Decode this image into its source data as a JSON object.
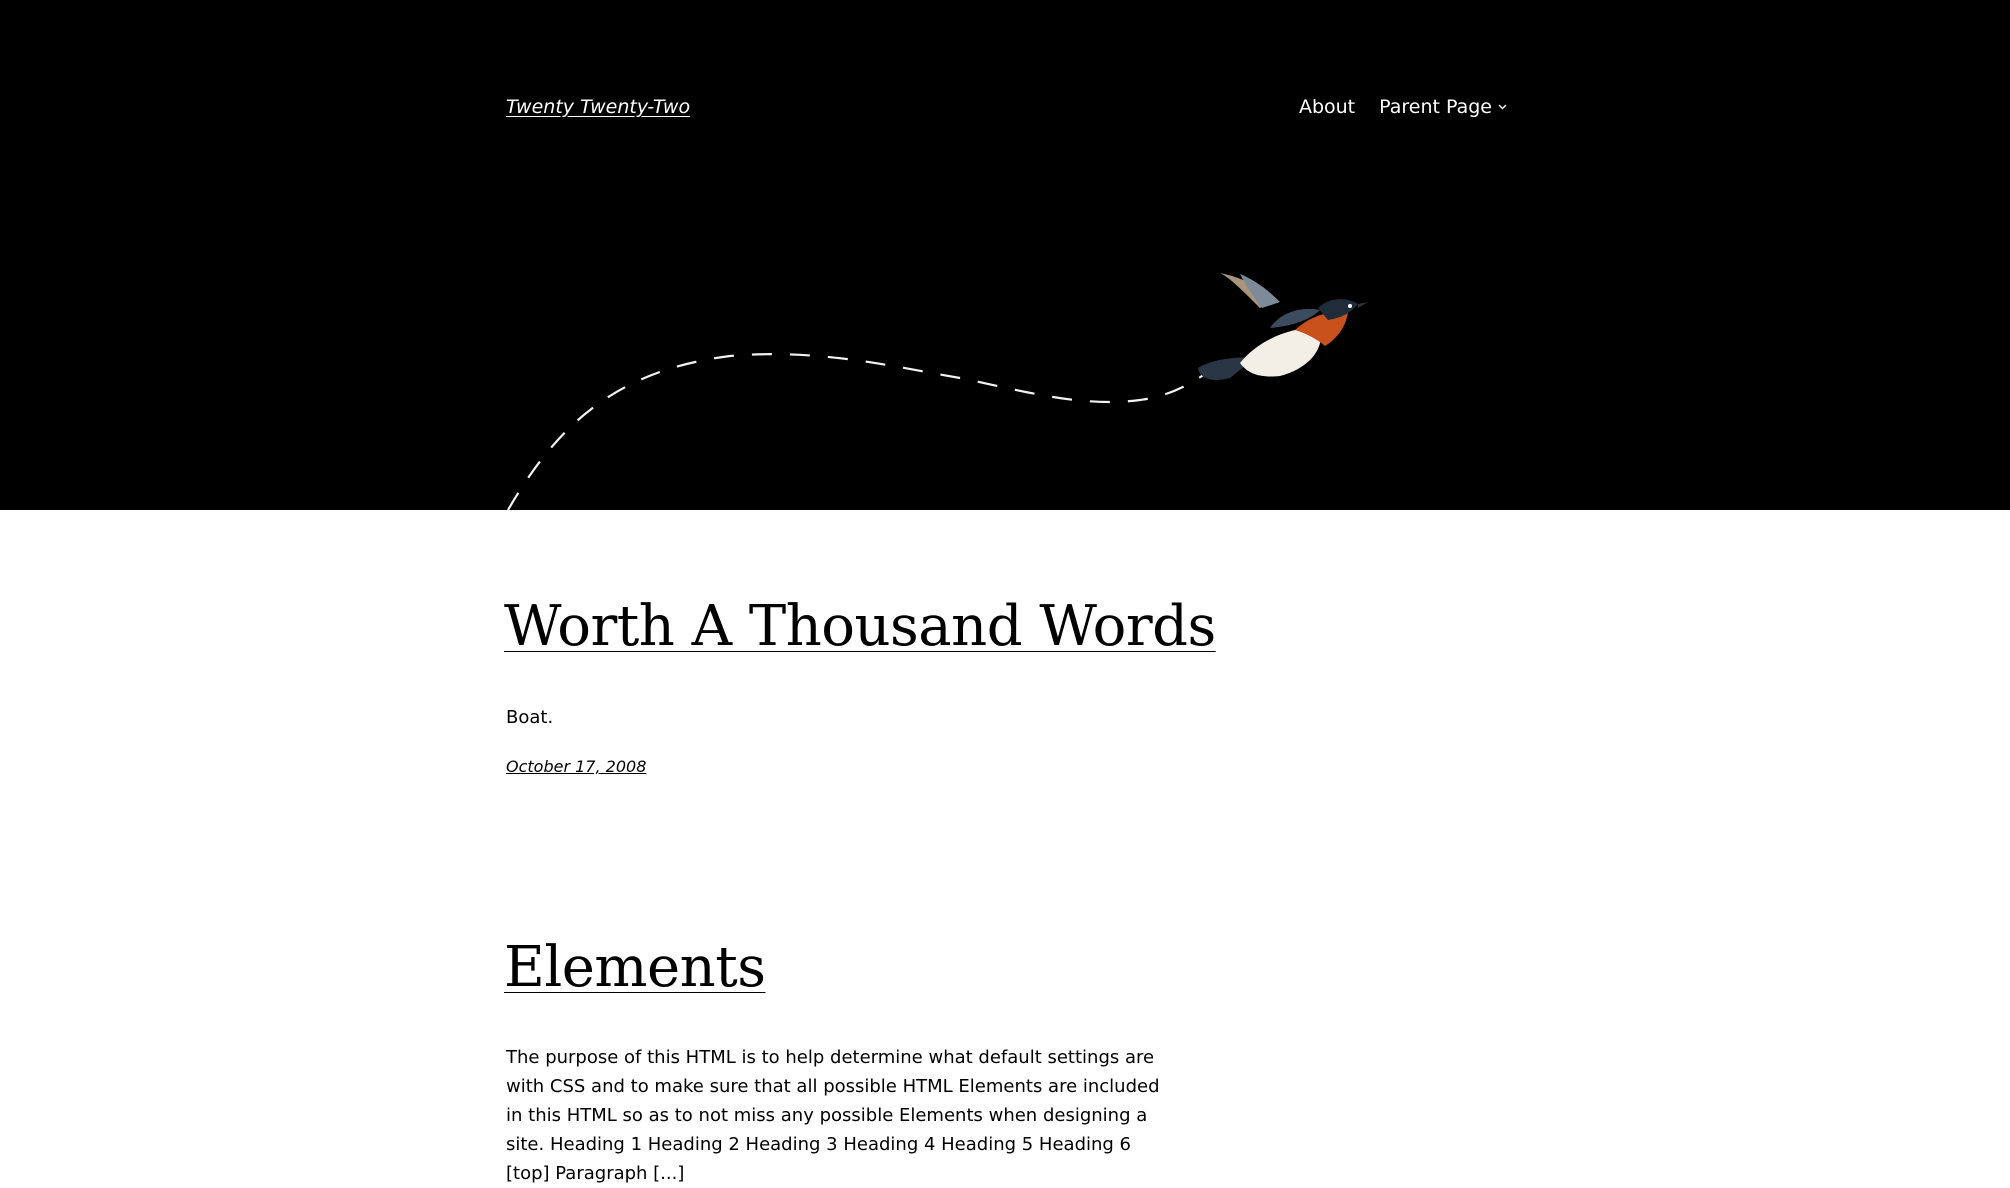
{
  "header": {
    "site_title": "Twenty Twenty-Two",
    "nav": [
      {
        "label": "About"
      },
      {
        "label": "Parent Page"
      }
    ]
  },
  "posts": [
    {
      "title": "Worth A Thousand Words",
      "excerpt": "Boat.",
      "date": "October 17, 2008"
    },
    {
      "title": "Elements",
      "excerpt": "The purpose of this HTML is to help determine what default settings are with CSS and to make sure that all possible HTML Elements are included in this HTML so as to not miss any possible Elements when designing a site. Heading 1 Heading 2 Heading 3 Heading 4 Heading 5 Heading 6 [top] Paragraph [...]"
    }
  ],
  "colors": {
    "header_bg": "#000000",
    "header_text": "#ffffff",
    "body_bg": "#ffffff",
    "body_text": "#000000"
  }
}
